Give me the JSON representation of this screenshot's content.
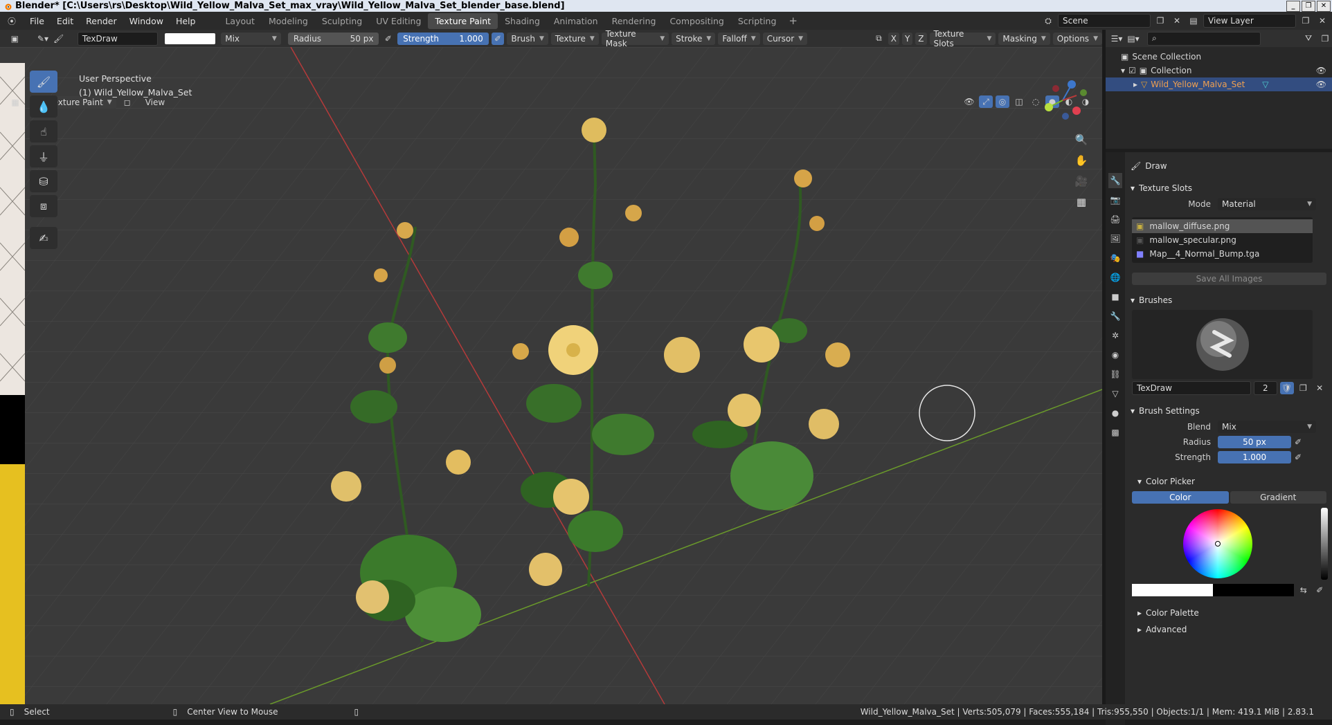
{
  "window": {
    "title": "Blender* [C:\\Users\\rs\\Desktop\\Wild_Yellow_Malva_Set_max_vray\\Wild_Yellow_Malva_Set_blender_base.blend]"
  },
  "menu": {
    "items": [
      "File",
      "Edit",
      "Render",
      "Window",
      "Help"
    ]
  },
  "workspaces": {
    "tabs": [
      "Layout",
      "Modeling",
      "Sculpting",
      "UV Editing",
      "Texture Paint",
      "Shading",
      "Animation",
      "Rendering",
      "Compositing",
      "Scripting"
    ],
    "active": "Texture Paint"
  },
  "scene": {
    "name": "Scene",
    "view_layer": "View Layer"
  },
  "toolheader": {
    "brush_name": "TexDraw",
    "blend": "Mix",
    "radius_label": "Radius",
    "radius_value": "50 px",
    "strength_label": "Strength",
    "strength_value": "1.000",
    "dropdowns": [
      "Brush",
      "Texture",
      "Texture Mask",
      "Stroke",
      "Falloff",
      "Cursor"
    ],
    "axis": [
      "X",
      "Y",
      "Z"
    ],
    "right_dropdowns": [
      "Texture Slots",
      "Masking",
      "Options"
    ]
  },
  "viewport_header": {
    "mode": "Texture Paint",
    "view": "View"
  },
  "viewport": {
    "perspective": "User Perspective",
    "object": "(1) Wild_Yellow_Malva_Set"
  },
  "outliner": {
    "root": "Scene Collection",
    "collection": "Collection",
    "object": "Wild_Yellow_Malva_Set"
  },
  "properties": {
    "tool_name": "Draw",
    "texture_slots": {
      "title": "Texture Slots",
      "mode_label": "Mode",
      "mode_value": "Material",
      "slots": [
        "mallow_diffuse.png",
        "mallow_specular.png",
        "Map__4_Normal_Bump.tga"
      ],
      "save_all": "Save All Images"
    },
    "brushes": {
      "title": "Brushes",
      "brush_name": "TexDraw",
      "users": "2"
    },
    "brush_settings": {
      "title": "Brush Settings",
      "blend_label": "Blend",
      "blend_value": "Mix",
      "radius_label": "Radius",
      "radius_value": "50 px",
      "strength_label": "Strength",
      "strength_value": "1.000"
    },
    "color_picker": {
      "title": "Color Picker",
      "tab_color": "Color",
      "tab_gradient": "Gradient"
    },
    "color_palette": "Color Palette",
    "advanced": "Advanced"
  },
  "statusbar": {
    "select": "Select",
    "center_view": "Center View to Mouse",
    "stats": "Wild_Yellow_Malva_Set | Verts:505,079 | Faces:555,184 | Tris:955,550 | Objects:1/1 | Mem: 419.1 MiB | 2.83.1"
  },
  "colors": {
    "accent": "#4772b3",
    "selection": "#334d80",
    "viewport_bg": "#3a3a3a",
    "x_axis": "#b53a3a",
    "y_axis": "#6a9a2a"
  }
}
